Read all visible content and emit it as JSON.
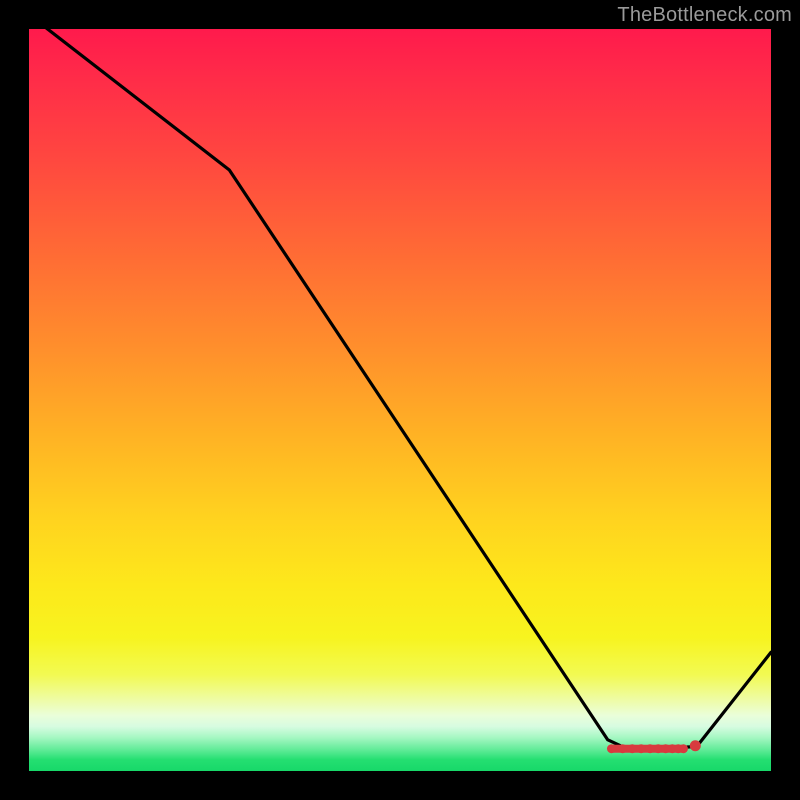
{
  "attribution": "TheBottleneck.com",
  "chart_data": {
    "type": "line",
    "title": "",
    "xlabel": "",
    "ylabel": "",
    "xlim": [
      0,
      100
    ],
    "ylim": [
      0,
      100
    ],
    "x": [
      0,
      2.5,
      27,
      78,
      81,
      90,
      100
    ],
    "values": [
      102,
      100,
      81,
      4.2,
      2.8,
      3.3,
      16
    ],
    "annotations": [],
    "marker_cluster": {
      "y": 3,
      "x_positions": [
        78.5,
        80,
        81.3,
        82.5,
        83.7,
        84.8,
        85.8,
        86.7,
        87.5,
        88.2,
        89.8
      ]
    }
  },
  "colors": {
    "background": "#000000",
    "curve": "#000000",
    "marker": "#d83a3f",
    "attribution_text": "#9a9a9a"
  }
}
